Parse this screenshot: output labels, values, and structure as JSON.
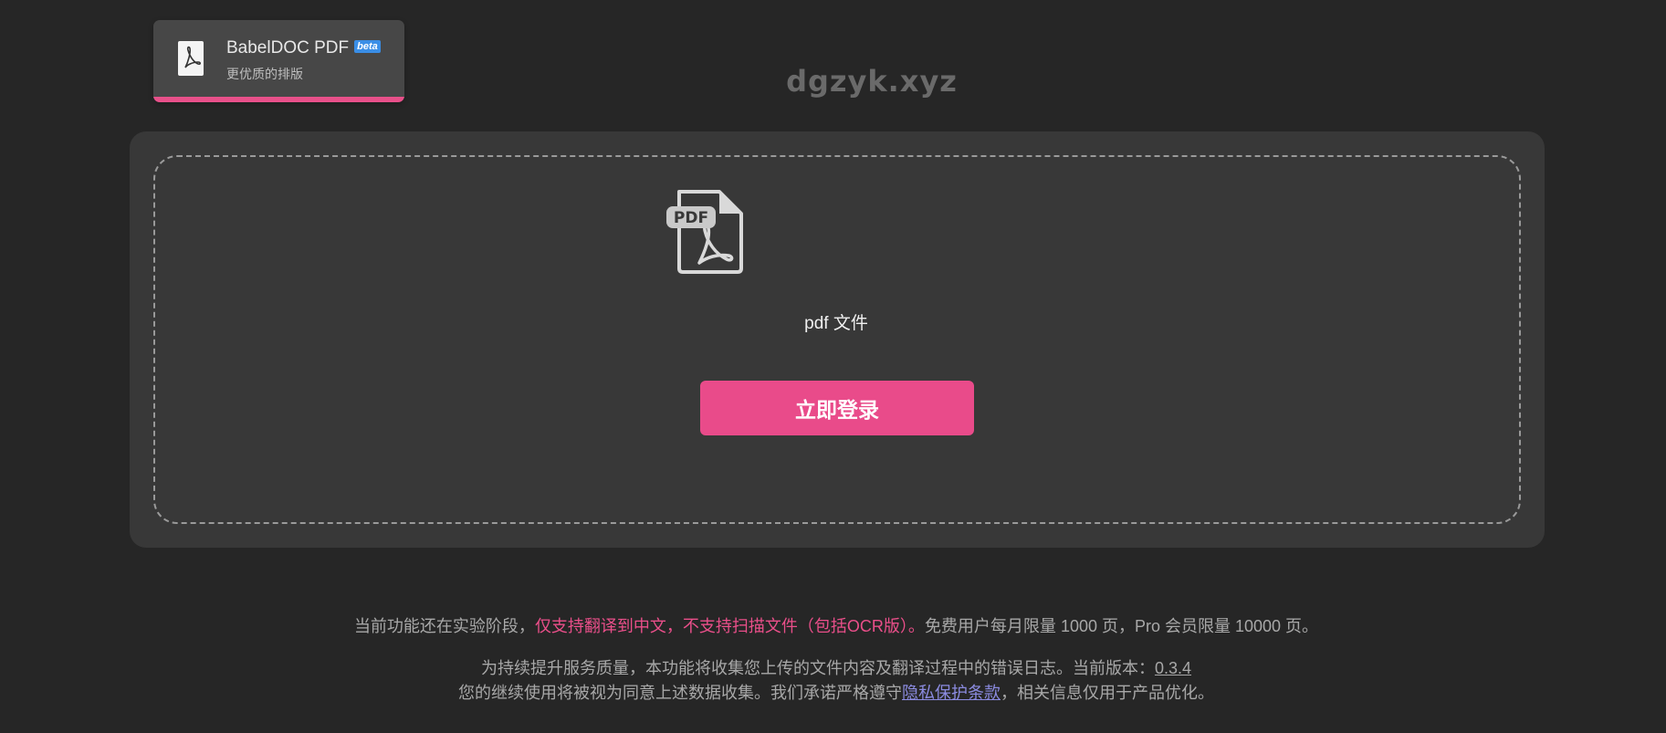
{
  "tab": {
    "title": "BabelDOC PDF",
    "badge": "beta",
    "subtitle": "更优质的排版",
    "icon": "pdf-file-icon"
  },
  "watermark": "dgzyk.xyz",
  "dropzone": {
    "icon": "pdf-document-icon",
    "icon_badge": "PDF",
    "file_label": "pdf 文件",
    "login_button": "立即登录"
  },
  "notice": {
    "line1_prefix": "当前功能还在实验阶段，",
    "line1_highlight": "仅支持翻译到中文，不支持扫描文件（包括OCR版）。",
    "line1_suffix": "免费用户每月限量 1000 页，Pro 会员限量 10000 页。",
    "line2_prefix": "为持续提升服务质量，本功能将收集您上传的文件内容及翻译过程中的错误日志。当前版本：",
    "version": "0.3.4",
    "line3_prefix": "您的继续使用将被视为同意上述数据收集。我们承诺严格遵守",
    "privacy_link": "隐私保护条款",
    "line3_suffix": "，相关信息仅用于产品优化。"
  },
  "colors": {
    "background": "#262626",
    "panel": "#383838",
    "accent": "#e94b8a",
    "badge": "#3a8ee6",
    "link": "#8b8be0"
  }
}
